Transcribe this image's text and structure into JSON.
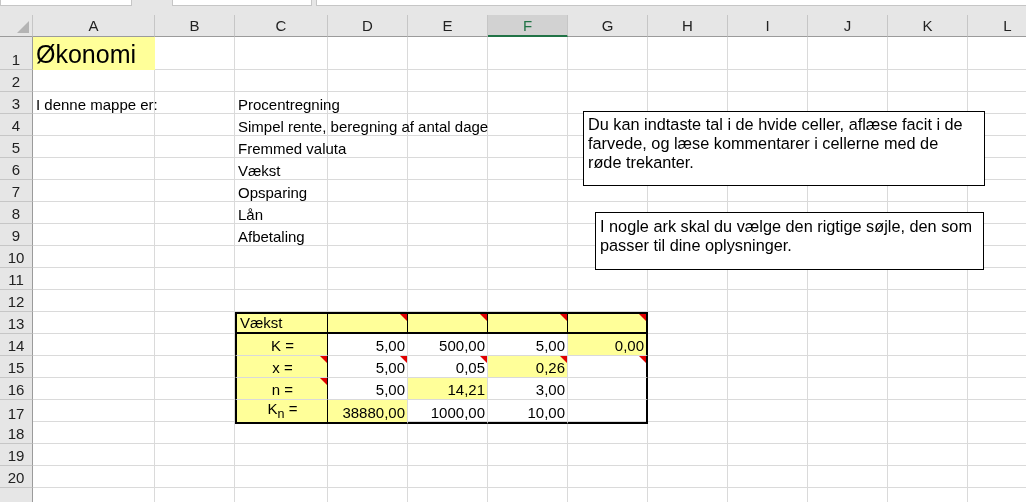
{
  "columns": [
    {
      "label": "A",
      "selected": false
    },
    {
      "label": "B",
      "selected": false
    },
    {
      "label": "C",
      "selected": false
    },
    {
      "label": "D",
      "selected": false
    },
    {
      "label": "E",
      "selected": false
    },
    {
      "label": "F",
      "selected": true
    },
    {
      "label": "G",
      "selected": false
    },
    {
      "label": "H",
      "selected": false
    },
    {
      "label": "I",
      "selected": false
    },
    {
      "label": "J",
      "selected": false
    },
    {
      "label": "K",
      "selected": false
    },
    {
      "label": "L",
      "selected": false
    }
  ],
  "row_numbers": [
    "1",
    "2",
    "3",
    "4",
    "5",
    "6",
    "7",
    "8",
    "9",
    "10",
    "11",
    "12",
    "13",
    "14",
    "15",
    "16",
    "17",
    "18",
    "19",
    "20"
  ],
  "title_cell": {
    "text": "Økonomi",
    "highlighted": true
  },
  "intro_label": "I denne mappe er:",
  "topics": [
    "Procentregning",
    "Simpel rente, beregning af antal dage",
    "Fremmed valuta",
    "Vækst",
    "Opsparing",
    "Lån",
    "Afbetaling"
  ],
  "table": {
    "title": {
      "text": "Vækst",
      "highlighted": true,
      "comment": false
    },
    "header_cells": [
      {
        "highlighted": true,
        "comment": true
      },
      {
        "highlighted": true,
        "comment": true
      },
      {
        "highlighted": true,
        "comment": true
      },
      {
        "highlighted": true,
        "comment": true
      }
    ],
    "rows": [
      {
        "label": {
          "text": "K =",
          "highlighted": true,
          "comment": false
        },
        "values": [
          {
            "text": "5,00",
            "highlighted": false,
            "comment": false
          },
          {
            "text": "500,00",
            "highlighted": false,
            "comment": false
          },
          {
            "text": "5,00",
            "highlighted": false,
            "comment": false
          },
          {
            "text": "0,00",
            "highlighted": true,
            "comment": false
          }
        ]
      },
      {
        "label": {
          "text": "x =",
          "highlighted": true,
          "comment": true
        },
        "values": [
          {
            "text": "5,00",
            "highlighted": false,
            "comment": true
          },
          {
            "text": "0,05",
            "highlighted": false,
            "comment": true
          },
          {
            "text": "0,26",
            "highlighted": true,
            "comment": true
          },
          {
            "highlighted": false,
            "comment": true
          }
        ]
      },
      {
        "label": {
          "text": "n =",
          "highlighted": true,
          "comment": true
        },
        "values": [
          {
            "text": "5,00",
            "highlighted": false,
            "comment": false
          },
          {
            "text": "14,21",
            "highlighted": true,
            "comment": false
          },
          {
            "text": "3,00",
            "highlighted": false,
            "comment": false
          },
          {
            "highlighted": false,
            "comment": false
          }
        ]
      },
      {
        "label": {
          "text": "K$_{n}$ =",
          "highlighted": true,
          "comment": false
        },
        "values": [
          {
            "text": "38880,00",
            "highlighted": true,
            "comment": false
          },
          {
            "text": "1000,00",
            "highlighted": false,
            "comment": false
          },
          {
            "text": "10,00",
            "highlighted": false,
            "comment": false
          },
          {
            "highlighted": false,
            "comment": false
          }
        ]
      }
    ]
  },
  "notes": [
    "Du kan indtaste tal i de hvide celler, aflæse facit i de farvede, og læse kommentarer i cellerne med de røde trekanter.",
    "I nogle ark skal du vælge den rigtige søjle, den som passer til dine oplysninger."
  ]
}
